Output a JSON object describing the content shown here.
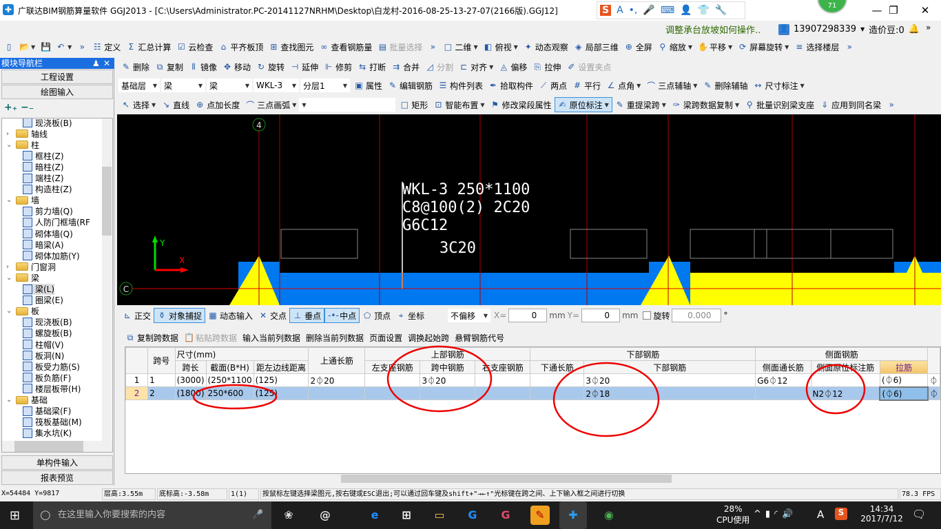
{
  "window": {
    "title": "广联达BIM钢筋算量软件 GGJ2013 - [C:\\Users\\Administrator.PC-20141127NRHM\\Desktop\\白龙村-2016-08-25-13-27-07(2166版).GGJ12]",
    "badge": "71",
    "minimize": "—",
    "restore": "❐",
    "close": "✕"
  },
  "ime": {
    "items": [
      "S",
      "A",
      "•,",
      "🎤",
      "⌨",
      "👤",
      "👕",
      "🔧"
    ]
  },
  "infobar": {
    "hint": "调整承台放坡如何操作..",
    "user": "13907298339",
    "beans": "造价豆:0",
    "more": "»"
  },
  "toolbar1": [
    {
      "icon": "▯",
      "label": ""
    },
    {
      "icon": "📂",
      "label": "",
      "dd": true
    },
    {
      "icon": "💾",
      "label": ""
    },
    {
      "icon": "↶",
      "label": "",
      "dd": true
    },
    {
      "icon": "»",
      "label": ""
    },
    {
      "icon": "☷",
      "label": "定义"
    },
    {
      "icon": "Σ",
      "label": "汇总计算"
    },
    {
      "icon": "☑",
      "label": "云检查"
    },
    {
      "icon": "⌂",
      "label": "平齐板顶"
    },
    {
      "icon": "⊞",
      "label": "查找图元"
    },
    {
      "icon": "∞",
      "label": "查看钢筋量"
    },
    {
      "icon": "▤",
      "label": "批量选择",
      "dis": true
    },
    {
      "icon": "»",
      "label": ""
    },
    {
      "icon": "□",
      "label": "二维",
      "dd": true
    },
    {
      "icon": "◧",
      "label": "俯视",
      "dd": true
    },
    {
      "icon": "✦",
      "label": "动态观察"
    },
    {
      "icon": "◈",
      "label": "局部三维"
    },
    {
      "icon": "⊕",
      "label": "全屏"
    },
    {
      "icon": "⚲",
      "label": "缩放",
      "dd": true
    },
    {
      "icon": "✋",
      "label": "平移",
      "dd": true
    },
    {
      "icon": "⟳",
      "label": "屏幕旋转",
      "dd": true
    },
    {
      "icon": "≡",
      "label": "选择楼层"
    },
    {
      "icon": "»",
      "label": ""
    }
  ],
  "toolbar2": [
    {
      "icon": "✎",
      "label": "删除"
    },
    {
      "icon": "⧉",
      "label": "复制"
    },
    {
      "icon": "⫴",
      "label": "镜像"
    },
    {
      "icon": "✥",
      "label": "移动"
    },
    {
      "icon": "↻",
      "label": "旋转"
    },
    {
      "icon": "⊣",
      "label": "延伸"
    },
    {
      "icon": "⊩",
      "label": "修剪"
    },
    {
      "icon": "⇆",
      "label": "打断"
    },
    {
      "icon": "⇉",
      "label": "合并"
    },
    {
      "icon": "◿",
      "label": "分割",
      "dis": true
    },
    {
      "icon": "⊏",
      "label": "对齐",
      "dd": true
    },
    {
      "icon": "◬",
      "label": "偏移"
    },
    {
      "icon": "⎘",
      "label": "拉伸"
    },
    {
      "icon": "✐",
      "label": "设置夹点",
      "dis": true
    }
  ],
  "selectors": {
    "floor": "基础层",
    "type1": "梁",
    "type2": "梁",
    "component": "WKL-3",
    "layer": "分层1"
  },
  "toolbar3": [
    {
      "icon": "▣",
      "label": "属性"
    },
    {
      "icon": "✎",
      "label": "编辑钢筋"
    },
    {
      "icon": "☰",
      "label": "构件列表"
    },
    {
      "icon": "✒",
      "label": "拾取构件"
    },
    {
      "icon": "⟋",
      "label": "两点"
    },
    {
      "icon": "#",
      "label": "平行"
    },
    {
      "icon": "∠",
      "label": "点角",
      "dd": true
    },
    {
      "icon": "⌒",
      "label": "三点辅轴",
      "dd": true
    },
    {
      "icon": "✎",
      "label": "删除辅轴"
    },
    {
      "icon": "↔",
      "label": "尺寸标注",
      "dd": true
    }
  ],
  "toolbar4": [
    {
      "icon": "↖",
      "label": "选择",
      "dd": true
    },
    {
      "icon": "↘",
      "label": "直线"
    },
    {
      "icon": "⊕",
      "label": "点加长度"
    },
    {
      "icon": "⌒",
      "label": "三点画弧",
      "dd": true
    },
    {
      "icon": "",
      "label": "",
      "blank": true,
      "dd": true
    },
    {
      "icon": "□",
      "label": "矩形"
    },
    {
      "icon": "⊡",
      "label": "智能布置",
      "dd": true
    },
    {
      "icon": "⚑",
      "label": "修改梁段属性"
    },
    {
      "icon": "✍",
      "label": "原位标注",
      "act": true,
      "dd": true
    },
    {
      "icon": "✎",
      "label": "重提梁跨",
      "dd": true
    },
    {
      "icon": "✑",
      "label": "梁跨数据复制",
      "dd": true
    },
    {
      "icon": "⚲",
      "label": "批量识别梁支座"
    },
    {
      "icon": "⇓",
      "label": "应用到同名梁"
    },
    {
      "icon": "»",
      "label": ""
    }
  ],
  "nav": {
    "title": "模块导航栏",
    "pin": "♟",
    "close": "✕",
    "project": "工程设置",
    "drawing": "绘图输入",
    "expand": "+₊",
    "collapse": "−₋",
    "single": "单构件输入",
    "report": "报表预览",
    "tree": [
      {
        "label": "现浇板(B)",
        "lvl": 1
      },
      {
        "label": "轴线",
        "lvl": 0,
        "folder": true,
        "open": false
      },
      {
        "label": "柱",
        "lvl": 0,
        "folder": true,
        "open": true
      },
      {
        "label": "框柱(Z)",
        "lvl": 1
      },
      {
        "label": "暗柱(Z)",
        "lvl": 1
      },
      {
        "label": "端柱(Z)",
        "lvl": 1
      },
      {
        "label": "构造柱(Z)",
        "lvl": 1
      },
      {
        "label": "墙",
        "lvl": 0,
        "folder": true,
        "open": true
      },
      {
        "label": "剪力墙(Q)",
        "lvl": 1
      },
      {
        "label": "人防门框墙(RF",
        "lvl": 1
      },
      {
        "label": "砌体墙(Q)",
        "lvl": 1
      },
      {
        "label": "暗梁(A)",
        "lvl": 1
      },
      {
        "label": "砌体加筋(Y)",
        "lvl": 1
      },
      {
        "label": "门窗洞",
        "lvl": 0,
        "folder": true,
        "open": false
      },
      {
        "label": "梁",
        "lvl": 0,
        "folder": true,
        "open": true
      },
      {
        "label": "梁(L)",
        "lvl": 1,
        "sel": true
      },
      {
        "label": "圈梁(E)",
        "lvl": 1
      },
      {
        "label": "板",
        "lvl": 0,
        "folder": true,
        "open": true
      },
      {
        "label": "现浇板(B)",
        "lvl": 1
      },
      {
        "label": "螺旋板(B)",
        "lvl": 1
      },
      {
        "label": "柱帽(V)",
        "lvl": 1
      },
      {
        "label": "板洞(N)",
        "lvl": 1
      },
      {
        "label": "板受力筋(S)",
        "lvl": 1
      },
      {
        "label": "板负筋(F)",
        "lvl": 1
      },
      {
        "label": "楼层板带(H)",
        "lvl": 1
      },
      {
        "label": "基础",
        "lvl": 0,
        "folder": true,
        "open": true
      },
      {
        "label": "基础梁(F)",
        "lvl": 1
      },
      {
        "label": "筏板基础(M)",
        "lvl": 1
      },
      {
        "label": "集水坑(K)",
        "lvl": 1
      }
    ]
  },
  "canvas": {
    "axis_top": "4",
    "axis_left": "C",
    "label_lines": [
      "WKL-3 250*1100",
      "C8@100(2) 2C20",
      "G6C12"
    ],
    "bottom_label": "3C20",
    "axis_x": "X",
    "axis_y": "Y"
  },
  "snapbar": {
    "items": [
      {
        "icon": "⊾",
        "label": "正交"
      },
      {
        "icon": "⚱",
        "label": "对象捕捉",
        "act": true
      },
      {
        "icon": "▦",
        "label": "动态输入"
      },
      {
        "icon": "✕",
        "label": "交点"
      },
      {
        "icon": "⊥",
        "label": "垂点",
        "act": true
      },
      {
        "icon": "-•-",
        "label": "中点",
        "act": true
      },
      {
        "icon": "⬠",
        "label": "顶点"
      },
      {
        "icon": "⌖",
        "label": "坐标"
      }
    ],
    "offset": "不偏移",
    "x_label": "X=",
    "x_value": "0",
    "y_label": "Y=",
    "y_value": "0",
    "unit": "mm",
    "rotate_label": "旋转",
    "rotate_value": "0.000",
    "deg": "°"
  },
  "table_toolbar": [
    {
      "icon": "⧉",
      "label": "复制跨数据"
    },
    {
      "icon": "📋",
      "label": "粘贴跨数据",
      "dis": true
    },
    {
      "label": "输入当前列数据"
    },
    {
      "label": "删除当前列数据"
    },
    {
      "label": "页面设置"
    },
    {
      "label": "调换起始跨"
    },
    {
      "label": "悬臂钢筋代号"
    }
  ],
  "table": {
    "groups": {
      "span_no": "跨号",
      "size": "尺寸(mm)",
      "top_through": "上通长筋",
      "top": "上部钢筋",
      "bottom": "下部钢筋",
      "side": "侧面钢筋"
    },
    "cols": {
      "span_len": "跨长",
      "section": "截面(B*H)",
      "dist": "距左边线距离",
      "left_sup": "左支座钢筋",
      "mid": "跨中钢筋",
      "right_sup": "右支座钢筋",
      "bot_through": "下通长筋",
      "bot": "下部钢筋",
      "side_through": "侧面通长筋",
      "side_orig": "侧面原位标注筋",
      "tie": "拉筋"
    },
    "rows": [
      {
        "n": "1",
        "span": "1",
        "len": "(3000)",
        "sec": "(250*1100",
        "dist": "(125)",
        "top_through": "2⏀20",
        "left": "",
        "mid": "3⏀20",
        "right": "",
        "bot_through": "",
        "bot": "3⏀20",
        "side_through": "G6⏀12",
        "side_orig": "",
        "tie": "(⏀6)",
        "extra": "⏀"
      },
      {
        "n": "2",
        "span": "2",
        "len": "(1800)",
        "sec": "250*600",
        "dist": "(125)",
        "top_through": "",
        "left": "",
        "mid": "",
        "right": "",
        "bot_through": "",
        "bot": "2⏀18",
        "side_through": "",
        "side_orig": "N2⏀12",
        "tie": "(⏀6)",
        "extra": "⏀"
      }
    ]
  },
  "status": {
    "coords": "X=54484 Y=9817",
    "floor_h": "层高:3.55m",
    "base_h": "底标高:-3.58m",
    "count": "1(1)",
    "msg": "按鼠标左键选择梁图元,按右键或ESC退出;可以通过回车键及shift+\"→←↑\"光标键在跨之间、上下输入框之间进行切换",
    "fps": "78.3 FPS"
  },
  "taskbar": {
    "search": "在这里输入你要搜索的内容",
    "cpu": "28%",
    "cpu_label": "CPU使用",
    "time": "14:34",
    "date": "2017/7/12",
    "ime": "A"
  }
}
